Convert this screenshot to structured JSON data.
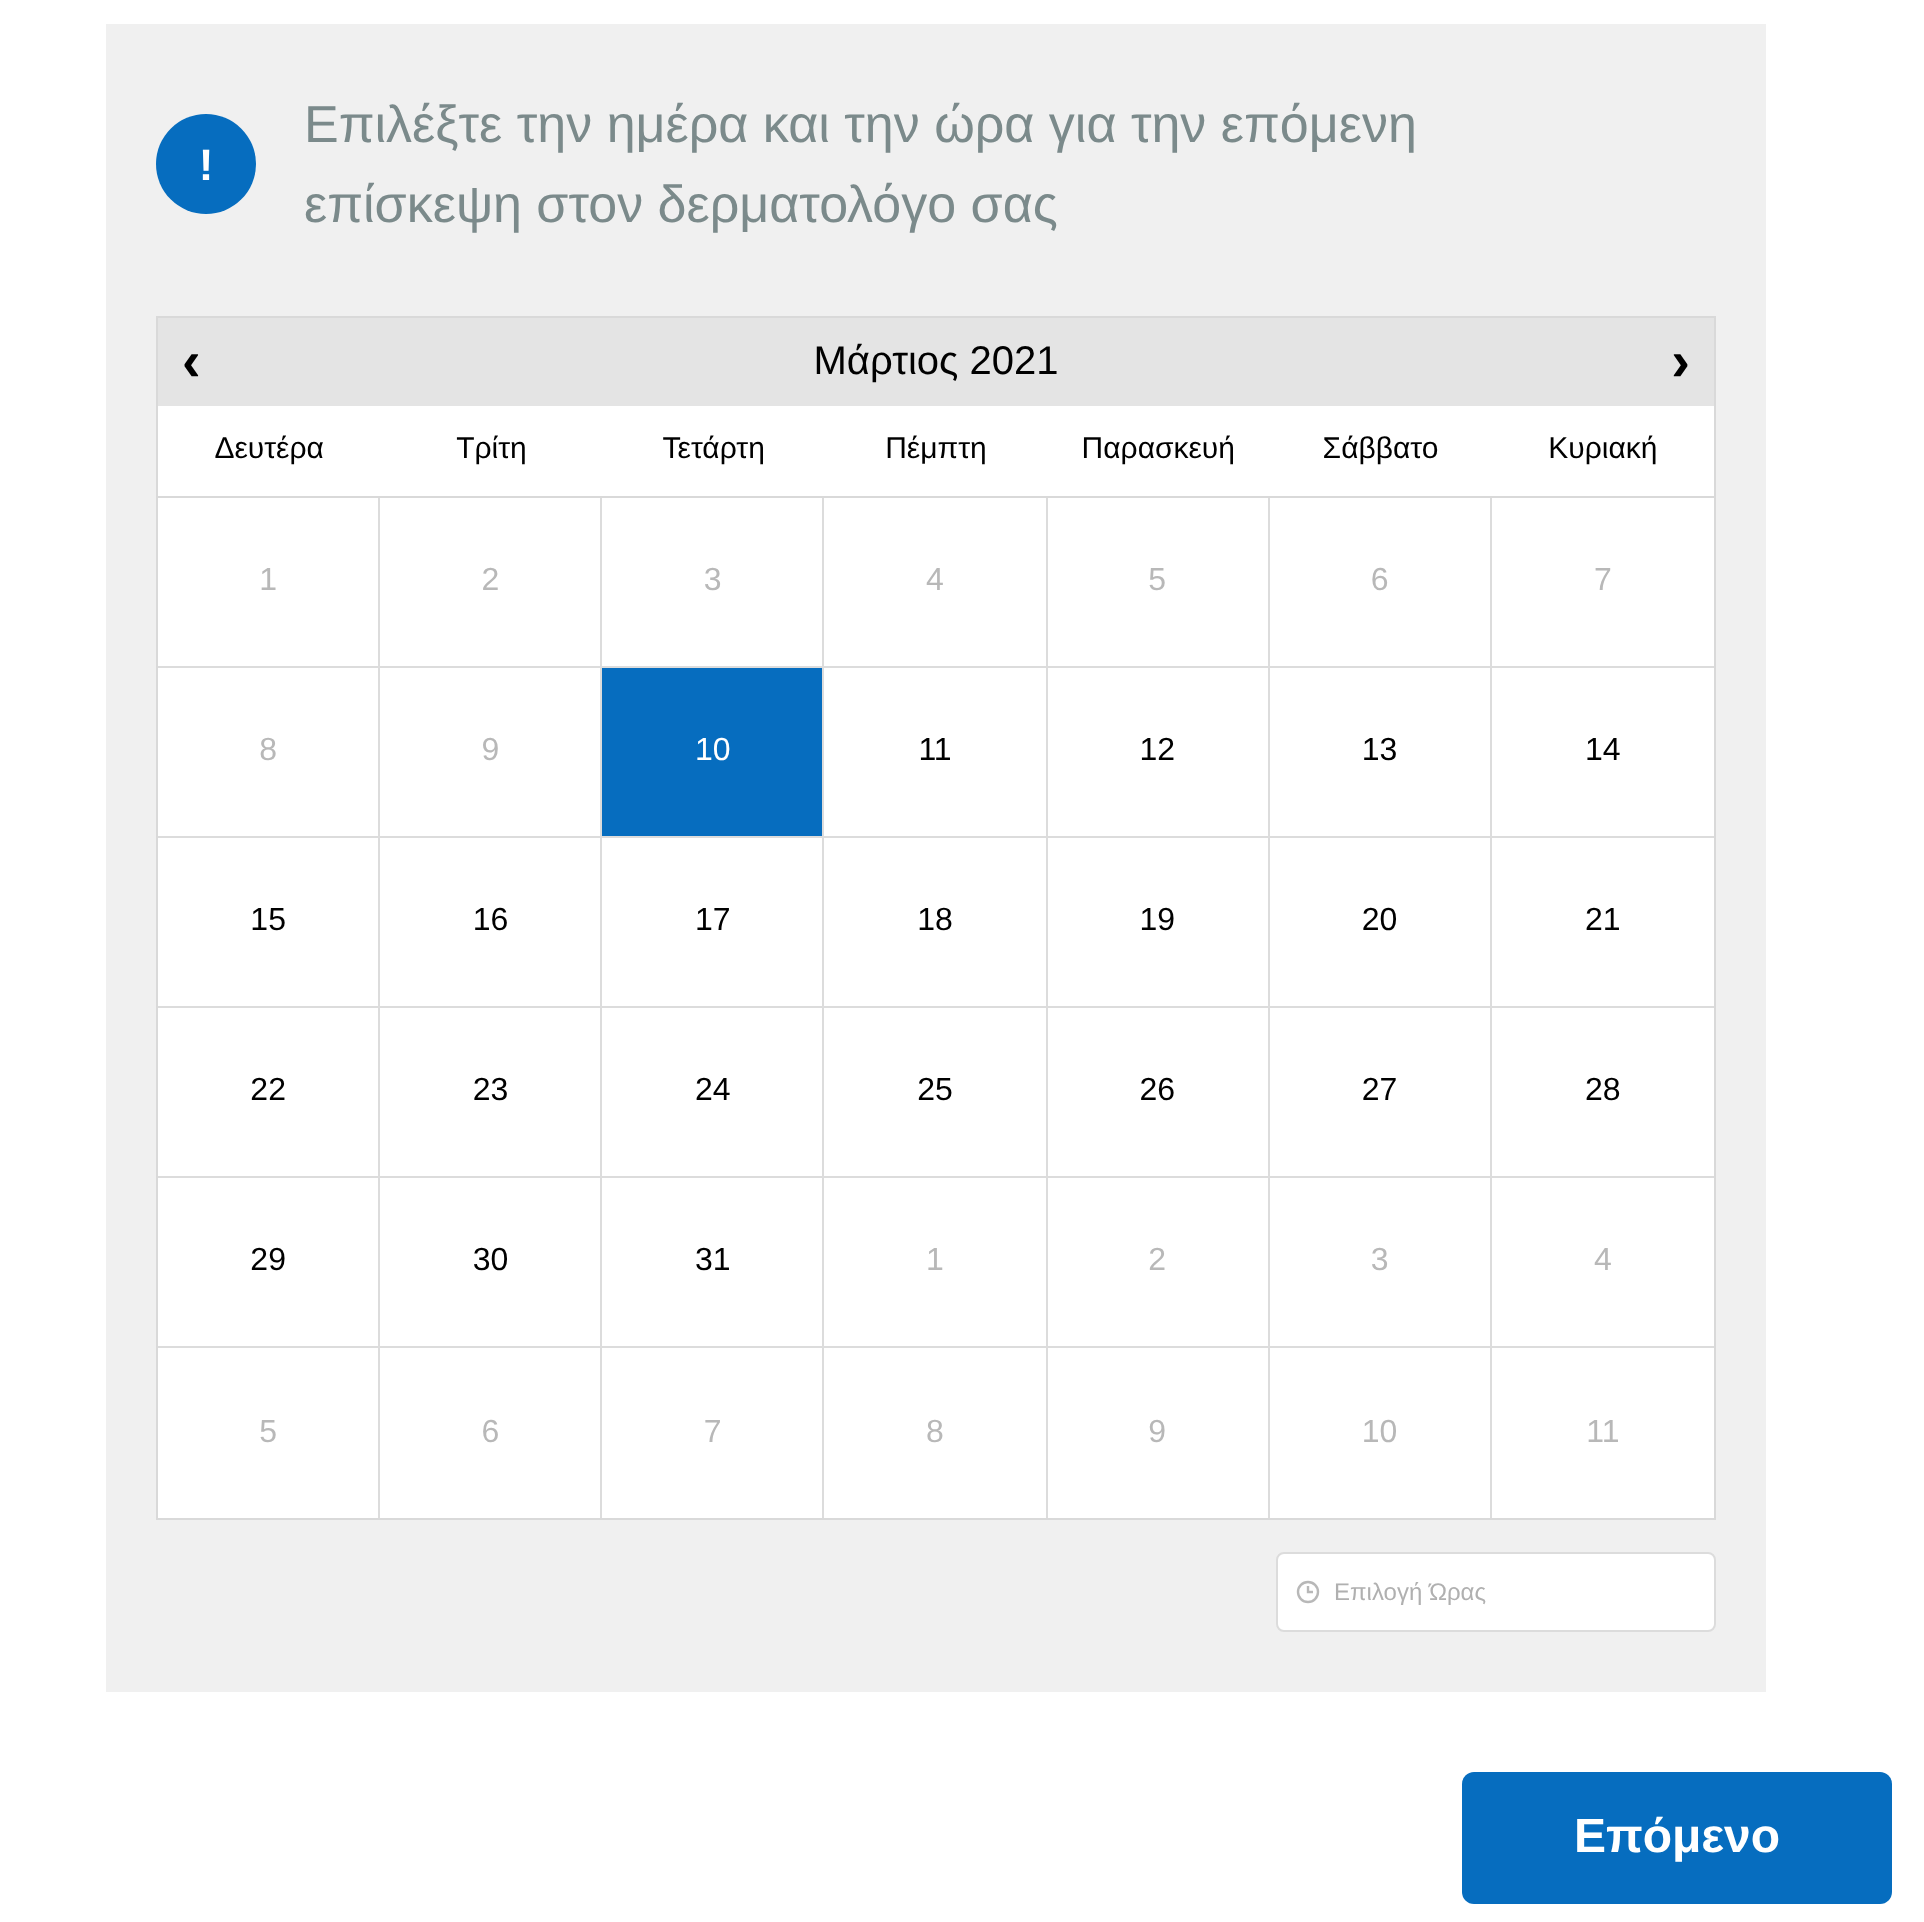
{
  "notice": {
    "text": "Επιλέξτε την ημέρα και την ώρα για την επόμενη επίσκεψη στον δερματολόγο σας",
    "icon_text": "!"
  },
  "calendar": {
    "title": "Μάρτιος 2021",
    "prev": "‹",
    "next": "›",
    "weekdays": [
      "Δευτέρα",
      "Τρίτη",
      "Τετάρτη",
      "Πέμπτη",
      "Παρασκευή",
      "Σάββατο",
      "Κυριακή"
    ],
    "days": [
      {
        "label": "1",
        "disabled": true,
        "selected": false
      },
      {
        "label": "2",
        "disabled": true,
        "selected": false
      },
      {
        "label": "3",
        "disabled": true,
        "selected": false
      },
      {
        "label": "4",
        "disabled": true,
        "selected": false
      },
      {
        "label": "5",
        "disabled": true,
        "selected": false
      },
      {
        "label": "6",
        "disabled": true,
        "selected": false
      },
      {
        "label": "7",
        "disabled": true,
        "selected": false
      },
      {
        "label": "8",
        "disabled": true,
        "selected": false
      },
      {
        "label": "9",
        "disabled": true,
        "selected": false
      },
      {
        "label": "10",
        "disabled": false,
        "selected": true
      },
      {
        "label": "11",
        "disabled": false,
        "selected": false
      },
      {
        "label": "12",
        "disabled": false,
        "selected": false
      },
      {
        "label": "13",
        "disabled": false,
        "selected": false
      },
      {
        "label": "14",
        "disabled": false,
        "selected": false
      },
      {
        "label": "15",
        "disabled": false,
        "selected": false
      },
      {
        "label": "16",
        "disabled": false,
        "selected": false
      },
      {
        "label": "17",
        "disabled": false,
        "selected": false
      },
      {
        "label": "18",
        "disabled": false,
        "selected": false
      },
      {
        "label": "19",
        "disabled": false,
        "selected": false
      },
      {
        "label": "20",
        "disabled": false,
        "selected": false
      },
      {
        "label": "21",
        "disabled": false,
        "selected": false
      },
      {
        "label": "22",
        "disabled": false,
        "selected": false
      },
      {
        "label": "23",
        "disabled": false,
        "selected": false
      },
      {
        "label": "24",
        "disabled": false,
        "selected": false
      },
      {
        "label": "25",
        "disabled": false,
        "selected": false
      },
      {
        "label": "26",
        "disabled": false,
        "selected": false
      },
      {
        "label": "27",
        "disabled": false,
        "selected": false
      },
      {
        "label": "28",
        "disabled": false,
        "selected": false
      },
      {
        "label": "29",
        "disabled": false,
        "selected": false
      },
      {
        "label": "30",
        "disabled": false,
        "selected": false
      },
      {
        "label": "31",
        "disabled": false,
        "selected": false
      },
      {
        "label": "1",
        "disabled": true,
        "selected": false
      },
      {
        "label": "2",
        "disabled": true,
        "selected": false
      },
      {
        "label": "3",
        "disabled": true,
        "selected": false
      },
      {
        "label": "4",
        "disabled": true,
        "selected": false
      },
      {
        "label": "5",
        "disabled": true,
        "selected": false
      },
      {
        "label": "6",
        "disabled": true,
        "selected": false
      },
      {
        "label": "7",
        "disabled": true,
        "selected": false
      },
      {
        "label": "8",
        "disabled": true,
        "selected": false
      },
      {
        "label": "9",
        "disabled": true,
        "selected": false
      },
      {
        "label": "10",
        "disabled": true,
        "selected": false
      },
      {
        "label": "11",
        "disabled": true,
        "selected": false
      }
    ]
  },
  "time_field": {
    "placeholder": "Επιλογή Ώρας"
  },
  "next_button": {
    "label": "Επόμενο"
  }
}
